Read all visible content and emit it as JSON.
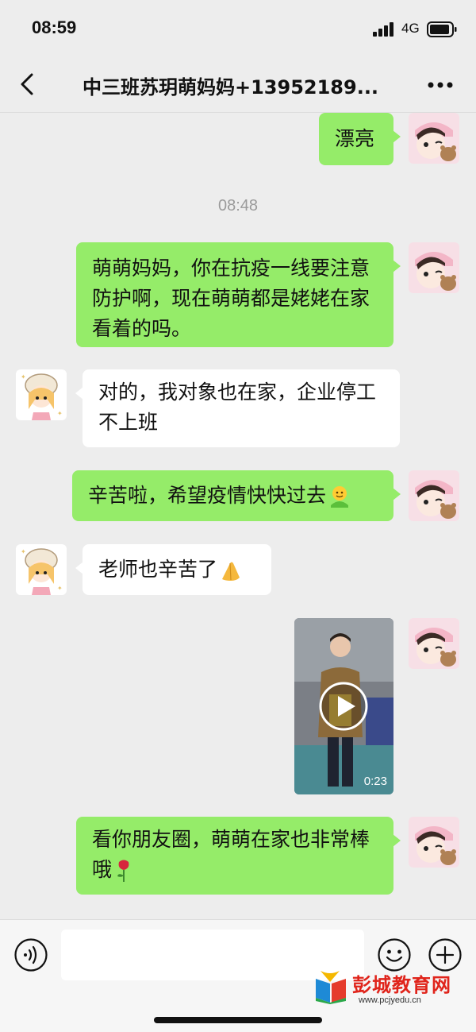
{
  "status": {
    "time": "08:59",
    "network": "4G"
  },
  "header": {
    "title": "中三班苏玥萌妈妈+13952189..."
  },
  "timestamp": "08:48",
  "messages": [
    {
      "from": "me",
      "text": "漂亮"
    },
    {
      "from": "me",
      "text": "萌萌妈妈，你在抗疫一线要注意防护啊，现在萌萌都是姥姥在家看着的吗。"
    },
    {
      "from": "other",
      "text": "对的，我对象也在家，企业停工不上班"
    },
    {
      "from": "me",
      "text": "辛苦啦，希望疫情快快过去",
      "emoji": "hug-icon"
    },
    {
      "from": "other",
      "text": "老师也辛苦了",
      "emoji": "clap-hands-icon"
    },
    {
      "from": "me",
      "type": "video",
      "duration": "0:23"
    },
    {
      "from": "me",
      "text": "看你朋友圈，萌萌在家也非常棒哦",
      "emoji": "rose-icon"
    }
  ],
  "input": {
    "placeholder": ""
  },
  "watermark": {
    "title": "彭城教育网",
    "url": "www.pcjyedu.cn"
  },
  "colors": {
    "my_bubble": "#95ec69",
    "their_bubble": "#ffffff",
    "background": "#ededed"
  }
}
